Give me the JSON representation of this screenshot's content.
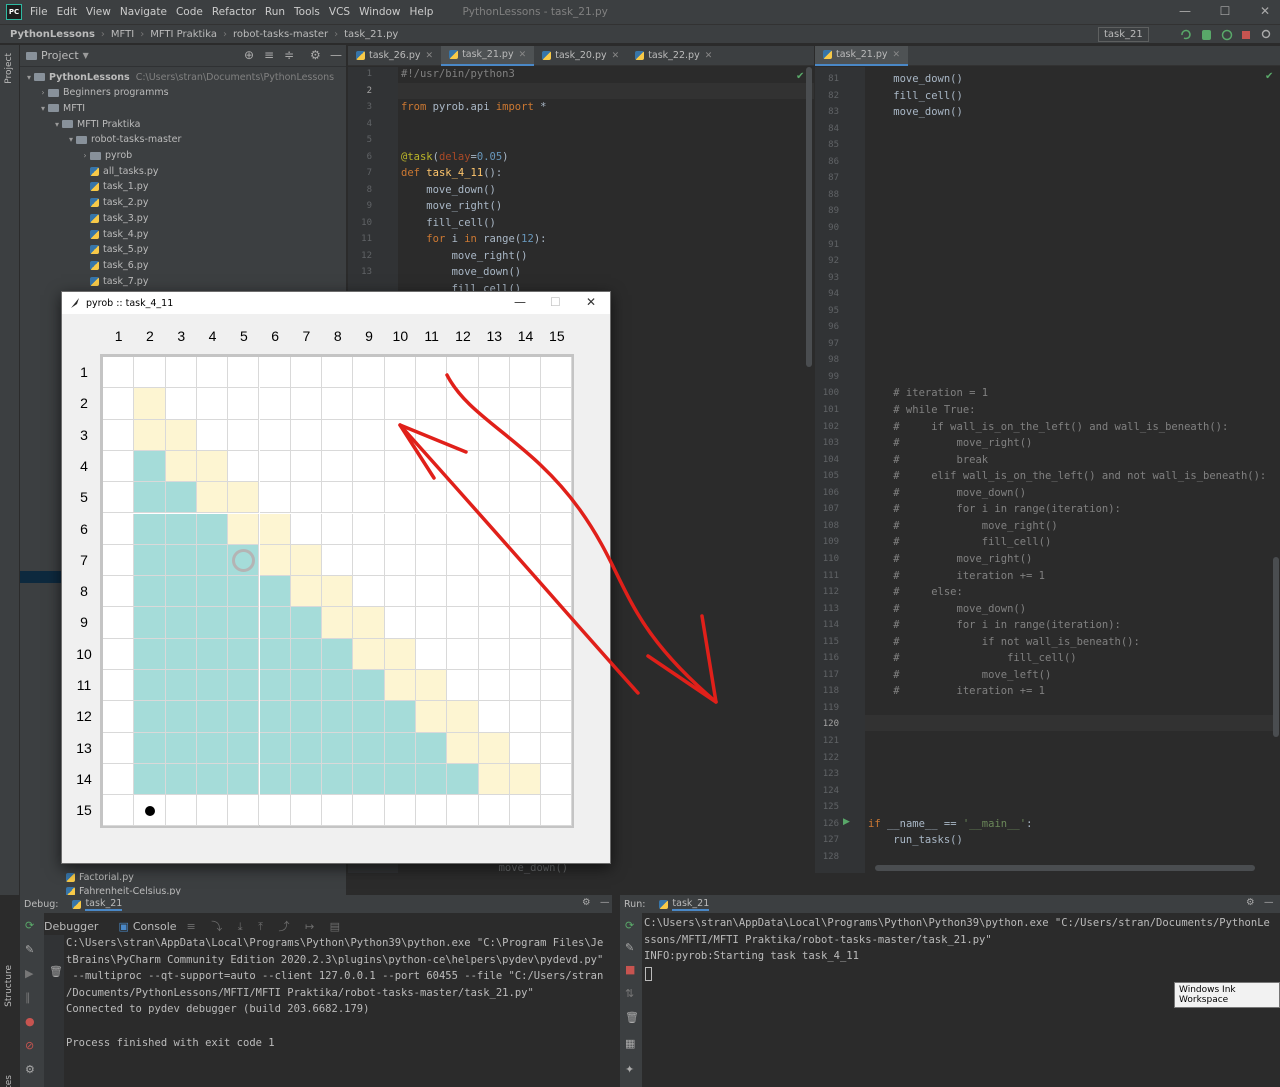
{
  "menubar": {
    "logo": "PC",
    "items": [
      "File",
      "Edit",
      "View",
      "Navigate",
      "Code",
      "Refactor",
      "Run",
      "Tools",
      "VCS",
      "Window",
      "Help"
    ],
    "window_title": "PythonLessons - task_21.py",
    "win_min": "—",
    "win_max": "☐",
    "win_close": "✕"
  },
  "navbar": {
    "crumbs": [
      "PythonLessons",
      "MFTI",
      "MFTI Praktika",
      "robot-tasks-master",
      "task_21.py"
    ],
    "sep": "›",
    "run_config": "task_21"
  },
  "leftstrip": {
    "project": "Project",
    "structure": "Structure",
    "favorites": "Favorites"
  },
  "project_panel": {
    "title": "Project",
    "rows": [
      {
        "label": "PythonLessons",
        "path": "C:\\Users\\stran\\Documents\\PythonLessons",
        "type": "folder",
        "open": true
      },
      {
        "label": "Beginners programms",
        "type": "folder",
        "open": false
      },
      {
        "label": "MFTI",
        "type": "folder",
        "open": true
      },
      {
        "label": "MFTI Praktika",
        "type": "folder",
        "open": true
      },
      {
        "label": "robot-tasks-master",
        "type": "folder",
        "open": true
      },
      {
        "label": "pyrob",
        "type": "folder",
        "open": false
      },
      {
        "label": "all_tasks.py",
        "type": "file"
      },
      {
        "label": "task_1.py",
        "type": "file"
      },
      {
        "label": "task_2.py",
        "type": "file"
      },
      {
        "label": "task_3.py",
        "type": "file"
      },
      {
        "label": "task_4.py",
        "type": "file"
      },
      {
        "label": "task_5.py",
        "type": "file"
      },
      {
        "label": "task_6.py",
        "type": "file"
      },
      {
        "label": "task_7.py",
        "type": "file"
      }
    ],
    "bottom_rows": [
      {
        "label": "Factorial.py",
        "type": "file"
      },
      {
        "label": "Fahrenheit-Celsius.py",
        "type": "file"
      }
    ]
  },
  "editor_main": {
    "tabs": [
      {
        "label": "task_26.py",
        "active": false
      },
      {
        "label": "task_21.py",
        "active": true
      },
      {
        "label": "task_20.py",
        "active": false
      },
      {
        "label": "task_22.py",
        "active": false
      }
    ],
    "line_numbers": [
      "1",
      "2",
      "3",
      "4",
      "5",
      "6",
      "7",
      "8",
      "9",
      "10",
      "11",
      "12",
      "13"
    ],
    "lines": [
      "#!/usr/bin/python3",
      "",
      "from pyrob.api import *",
      "",
      "",
      "@task(delay=0.05)",
      "def task_4_11():",
      "    move_down()",
      "    move_right()",
      "    fill_cell()",
      "    for i in range(12):",
      "        move_right()",
      "        move_down()",
      "        fill_cell()"
    ],
    "below_window_line": "        move_down()"
  },
  "editor_right": {
    "tab": "task_21.py",
    "line_numbers": [
      "81",
      "82",
      "83",
      "84",
      "85",
      "86",
      "87",
      "88",
      "89",
      "90",
      "91",
      "92",
      "93",
      "94",
      "95",
      "96",
      "97",
      "98",
      "99",
      "100",
      "101",
      "102",
      "103",
      "104",
      "105",
      "106",
      "107",
      "108",
      "109",
      "110",
      "111",
      "112",
      "113",
      "114",
      "115",
      "116",
      "117",
      "118",
      "119",
      "120",
      "121",
      "122",
      "123",
      "124",
      "125",
      "126",
      "127",
      "128"
    ],
    "lines": [
      "    move_down()",
      "    fill_cell()",
      "    move_down()",
      "",
      "",
      "",
      "",
      "",
      "",
      "",
      "",
      "",
      "",
      "",
      "",
      "",
      "",
      "",
      "",
      "    # iteration = 1",
      "    # while True:",
      "    #     if wall_is_on_the_left() and wall_is_beneath():",
      "    #         move_right()",
      "    #         break",
      "    #     elif wall_is_on_the_left() and not wall_is_beneath():",
      "    #         move_down()",
      "    #         for i in range(iteration):",
      "    #             move_right()",
      "    #             fill_cell()",
      "    #         move_right()",
      "    #         iteration += 1",
      "    #     else:",
      "    #         move_down()",
      "    #         for i in range(iteration):",
      "    #             if not wall_is_beneath():",
      "    #                 fill_cell()",
      "    #             move_left()",
      "    #         iteration += 1",
      "",
      "",
      "",
      "",
      "",
      "",
      "",
      "if __name__ == '__main__':",
      "    run_tasks()",
      ""
    ]
  },
  "pyrob_window": {
    "title": "pyrob :: task_4_11",
    "btn_min": "—",
    "btn_max": "☐",
    "btn_close": "✕",
    "columns": [
      "1",
      "2",
      "3",
      "4",
      "5",
      "6",
      "7",
      "8",
      "9",
      "10",
      "11",
      "12",
      "13",
      "14",
      "15"
    ],
    "rows": [
      "1",
      "2",
      "3",
      "4",
      "5",
      "6",
      "7",
      "8",
      "9",
      "10",
      "11",
      "12",
      "13",
      "14",
      "15"
    ],
    "colors": {
      "filled": "#a5dcd9",
      "path": "#fdf5d2",
      "empty": "#ffffff",
      "robot": "#000000",
      "target_ring": "#b4b4b4",
      "arrow": "#e0201a"
    },
    "robot_position": {
      "row": 15,
      "col": 2
    },
    "target_marker": {
      "row": 7,
      "col": 5
    }
  },
  "debug_panel": {
    "label": "Debug:",
    "run_tab": "task_21",
    "tabs": [
      "Debugger",
      "Console"
    ],
    "lines": [
      "C:\\Users\\stran\\AppData\\Local\\Programs\\Python\\Python39\\python.exe \"C:\\Program Files\\Je",
      "tBrains\\PyCharm Community Edition 2020.2.3\\plugins\\python-ce\\helpers\\pydev\\pydevd.py\"",
      " --multiproc --qt-support=auto --client 127.0.0.1 --port 60455 --file \"C:/Users/stran",
      "/Documents/PythonLessons/MFTI/MFTI Praktika/robot-tasks-master/task_21.py\"",
      "Connected to pydev debugger (build 203.6682.179)",
      "",
      "Process finished with exit code 1"
    ]
  },
  "run_panel": {
    "label": "Run:",
    "run_tab": "task_21",
    "lines": [
      "C:\\Users\\stran\\AppData\\Local\\Programs\\Python\\Python39\\python.exe \"C:/Users/stran/Documents/PythonLe",
      "ssons/MFTI/MFTI Praktika/robot-tasks-master/task_21.py\"",
      "INFO:pyrob:Starting task task_4_11"
    ]
  },
  "tooltip": "Windows Ink Workspace"
}
